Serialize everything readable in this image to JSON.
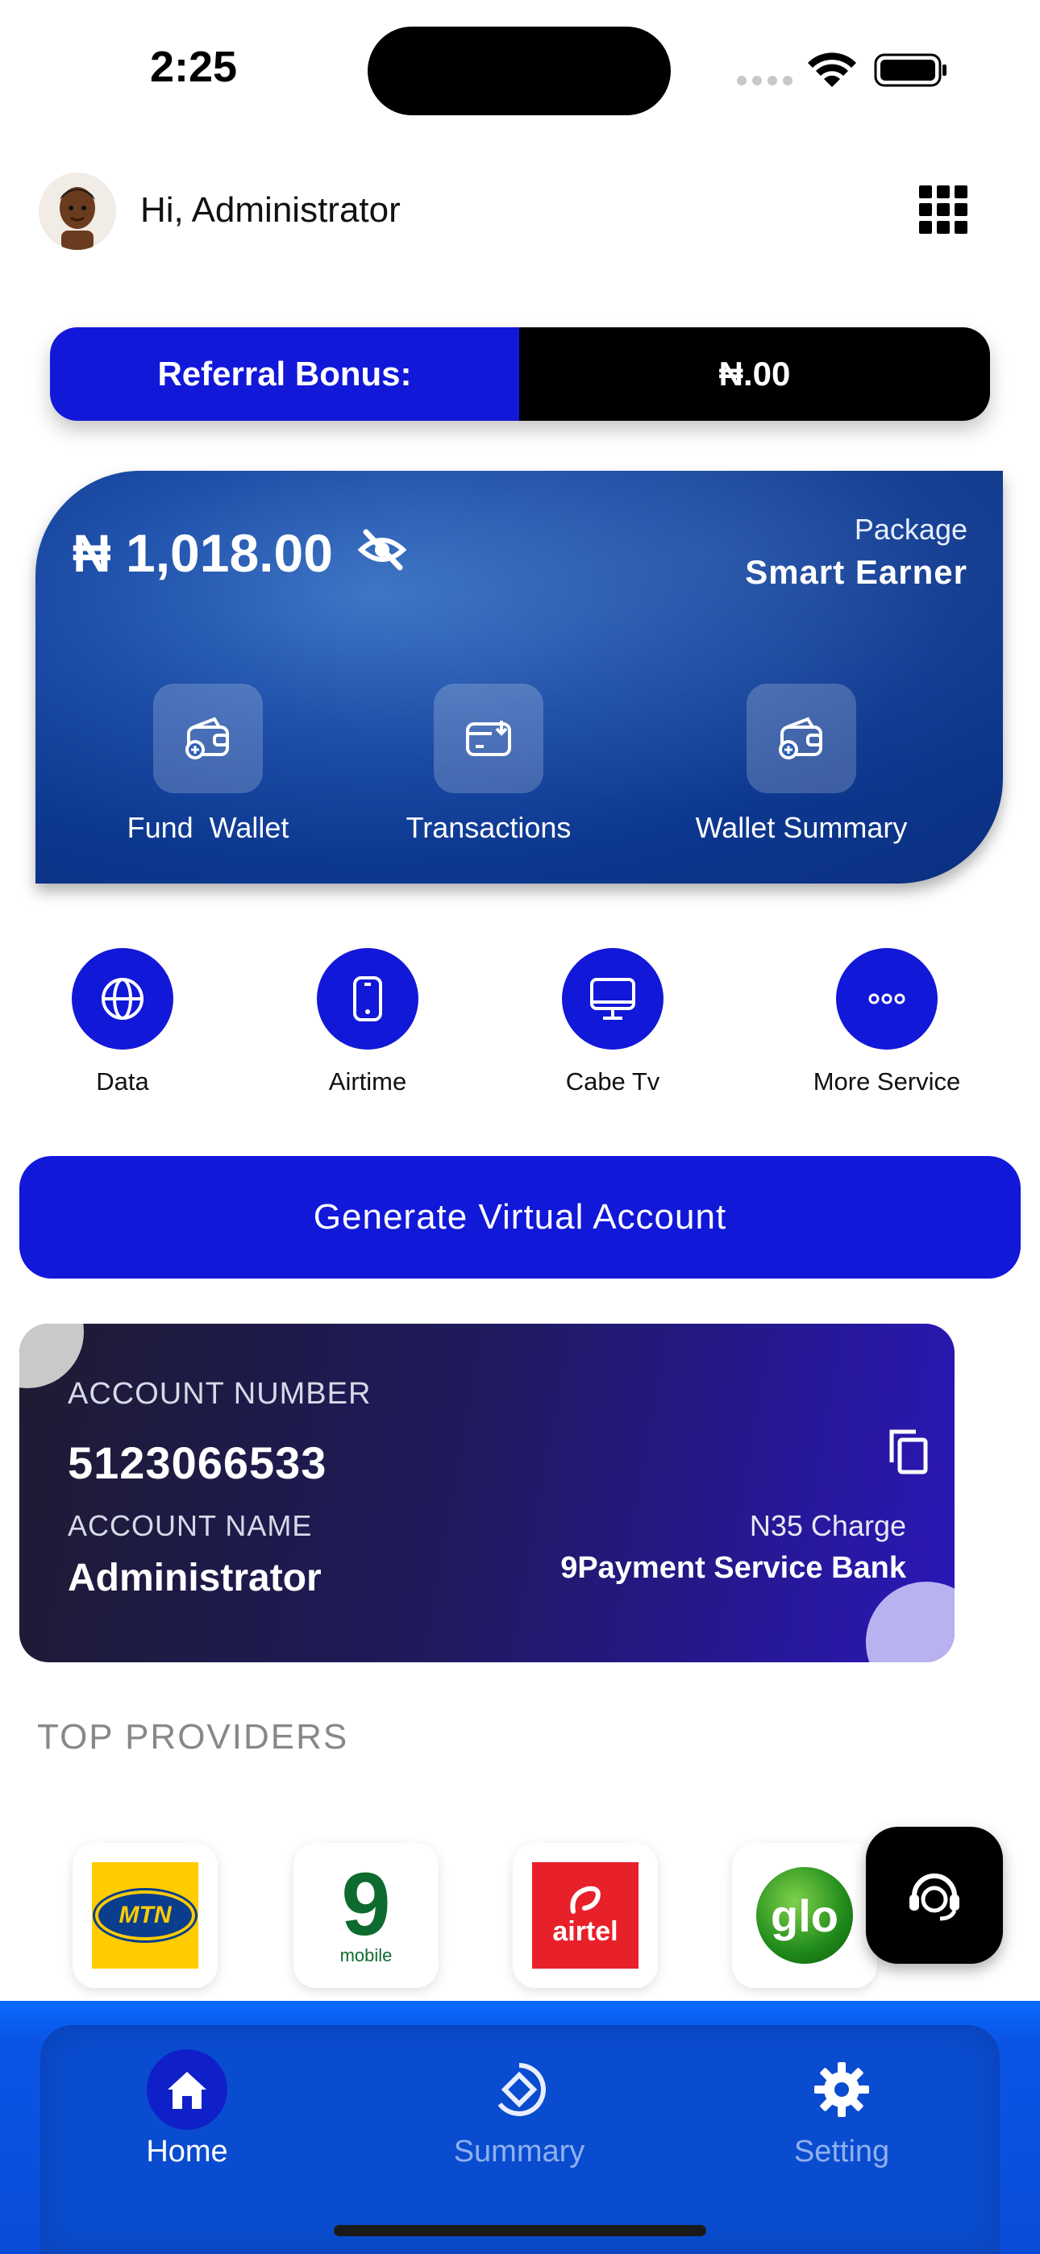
{
  "status_bar": {
    "time": "2:25"
  },
  "header": {
    "greeting": "Hi, Administrator"
  },
  "referral": {
    "label": "Referral Bonus:",
    "value": "₦.00"
  },
  "wallet": {
    "balance": "₦ 1,018.00",
    "package_label": "Package",
    "package_name": "Smart Earner",
    "actions": [
      {
        "label": "Fund  Wallet",
        "icon": "wallet-add-icon"
      },
      {
        "label": "Transactions",
        "icon": "card-receive-icon"
      },
      {
        "label": "Wallet Summary",
        "icon": "wallet-add-icon"
      }
    ]
  },
  "services": [
    {
      "label": "Data",
      "icon": "globe-icon"
    },
    {
      "label": "Airtime",
      "icon": "mobile-icon"
    },
    {
      "label": "Cabe Tv",
      "icon": "monitor-icon"
    },
    {
      "label": "More Service",
      "icon": "more-dots-icon"
    }
  ],
  "generate_button": "Generate Virtual Account",
  "account": {
    "number_label": "ACCOUNT NUMBER",
    "number": "5123066533",
    "name_label": "ACCOUNT NAME",
    "name": "Administrator",
    "charge": "N35 Charge",
    "bank": "9Payment Service Bank"
  },
  "providers": {
    "title": "TOP PROVIDERS",
    "items": [
      {
        "name": "MTN",
        "logo_text": "MTN"
      },
      {
        "name": "9mobile",
        "logo_text": "9",
        "logo_sub": "mobile"
      },
      {
        "name": "airtel",
        "logo_text": "airtel"
      },
      {
        "name": "glo",
        "logo_text": "glo"
      }
    ]
  },
  "bottom_nav": {
    "items": [
      {
        "label": "Home",
        "active": true
      },
      {
        "label": "Summary",
        "active": false
      },
      {
        "label": "Setting",
        "active": false
      }
    ]
  },
  "colors": {
    "primary": "#1218d8",
    "nav": "#0a4cd6",
    "wallet": "#1d4ea8"
  }
}
